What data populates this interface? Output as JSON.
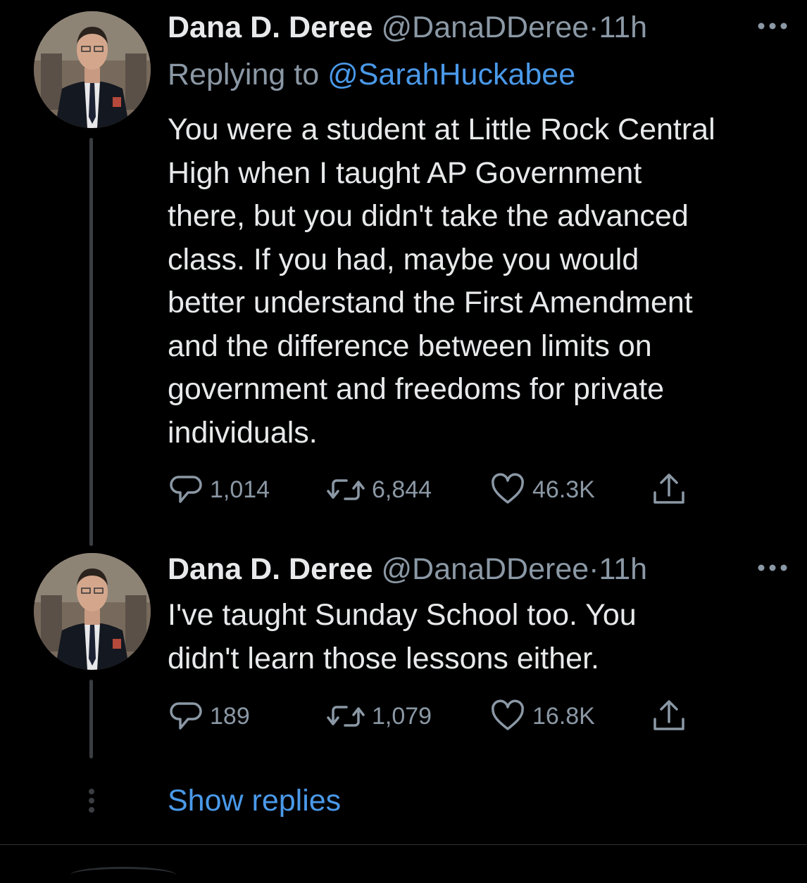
{
  "tweets": [
    {
      "author_name": "Dana D. Deree",
      "handle": "@DanaDDeree",
      "separator": "·",
      "time": "11h",
      "replying_label": "Replying to",
      "replying_to": "@SarahHuckabee",
      "text": "You were a student at Little Rock Central\nHigh when I taught AP Government\nthere, but you didn't take the advanced\nclass. If you had, maybe you would\nbetter understand the First Amendment\nand the difference between limits on\ngovernment and freedoms for private\nindividuals.",
      "replies": "1,014",
      "retweets": "6,844",
      "likes": "46.3K"
    },
    {
      "author_name": "Dana D. Deree",
      "handle": "@DanaDDeree",
      "separator": "·",
      "time": "11h",
      "text": "I've taught Sunday School too. You\ndidn't learn those lessons either.",
      "replies": "189",
      "retweets": "1,079",
      "likes": "16.8K"
    }
  ],
  "show_replies_label": "Show replies",
  "icons": {
    "reply": "reply-icon",
    "retweet": "retweet-icon",
    "like": "heart-icon",
    "share": "share-icon",
    "more": "more-icon"
  },
  "colors": {
    "background": "#000000",
    "text": "#e7e9ea",
    "muted": "#8b98a5",
    "link": "#4a99e9",
    "thread_line": "#3a3d41"
  }
}
